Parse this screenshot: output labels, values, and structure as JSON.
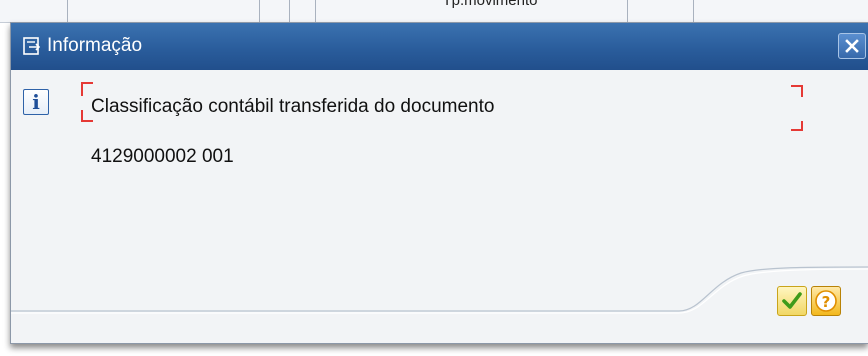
{
  "background": {
    "column_header": "Tp.movimento"
  },
  "dialog": {
    "title": "Informação",
    "message_line1": "Classificação contábil transferida do documento",
    "message_line2": "4129000002 001",
    "message_type": "info-icon",
    "buttons": [
      {
        "name": "continue-button",
        "icon": "checkmark-icon"
      },
      {
        "name": "help-button",
        "icon": "question-mark-icon"
      }
    ]
  },
  "colors": {
    "titlebar": "#2a5d9c",
    "dialog_bg": "#f2f4f6",
    "focus_marker": "#e53935",
    "ok_check": "#4caf1f",
    "help_orange": "#f3a51d"
  }
}
